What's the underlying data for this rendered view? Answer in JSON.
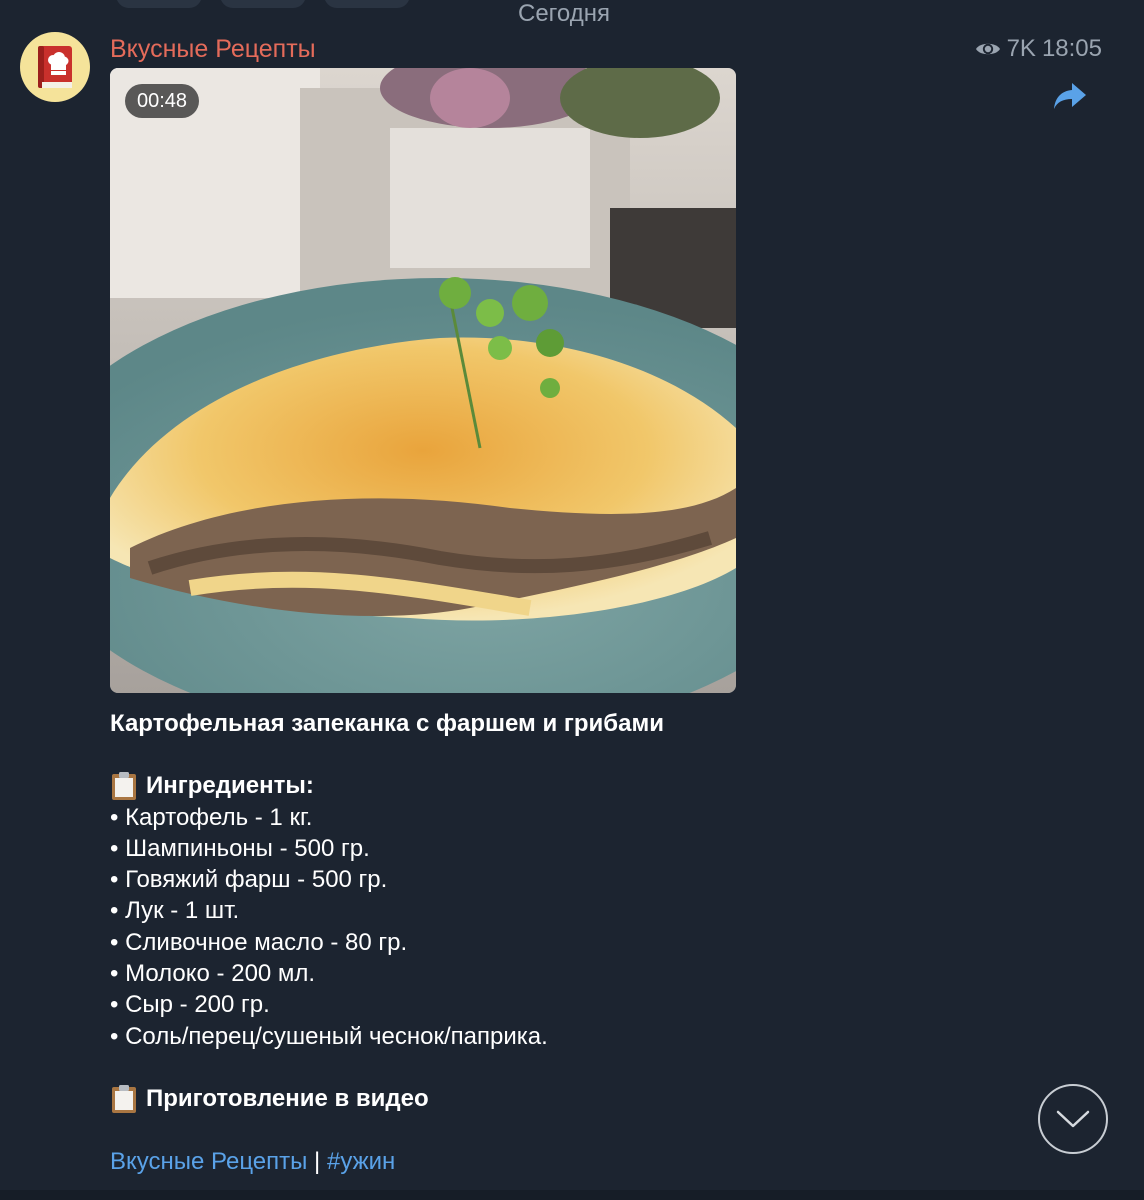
{
  "date_header": "Сегодня",
  "channel": {
    "name": "Вкусные Рецепты",
    "name_color": "#e46b5a",
    "avatar_icon": "cookbook-chef-icon"
  },
  "meta": {
    "views": "7K",
    "time": "18:05",
    "eye_icon": "eye-icon",
    "share_icon": "share-arrow-icon"
  },
  "video": {
    "duration": "00:48",
    "subject": "casserole-on-plate-thumbnail"
  },
  "post": {
    "title": "Картофельная запеканка с фаршем и грибами",
    "ingredients_heading": "Ингредиенты:",
    "ingredients": [
      "• Картофель - 1 кг.",
      "• Шампиньоны - 500 гр.",
      "• Говяжий фарш - 500 гр.",
      "• Лук - 1 шт.",
      "• Сливочное масло - 80 гр.",
      "• Молоко - 200 мл.",
      "• Сыр - 200 гр.",
      "• Соль/перец/сушеный чеснок/паприка."
    ],
    "preparation_heading": "Приготовление в видео",
    "heading_icon": "clipboard-icon"
  },
  "footer": {
    "channel_link": "Вкусные Рецепты",
    "separator": " | ",
    "hashtag": "#ужин",
    "link_color": "#5aa2e8"
  },
  "controls": {
    "scroll_down_icon": "chevron-down-icon"
  }
}
